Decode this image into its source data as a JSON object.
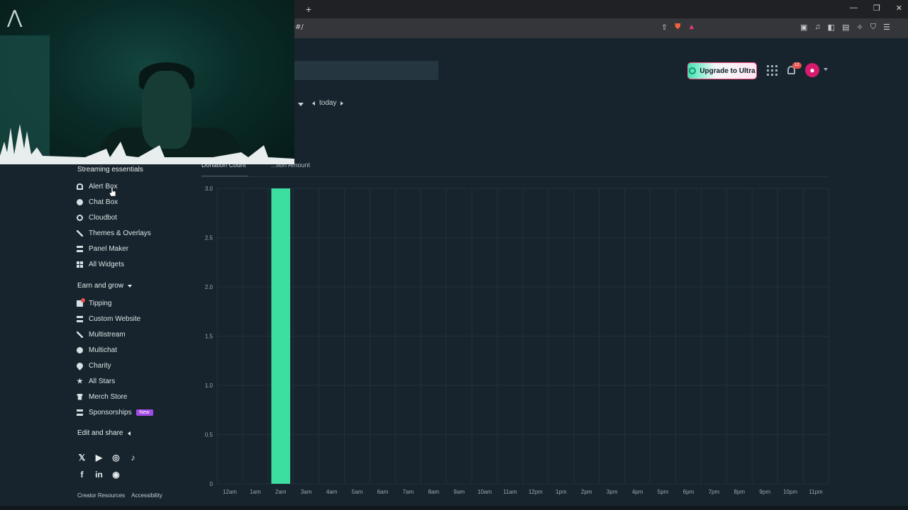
{
  "browser": {
    "url": "#/",
    "new_tab": "+",
    "window_controls": [
      "—",
      "❐",
      "✕"
    ]
  },
  "header": {
    "upgrade_label": "Upgrade to Ultra",
    "notification_count": "12",
    "date_nav_label": "today"
  },
  "sidebar": {
    "streaming_heading": "Streaming essentials",
    "streaming_items": [
      "Alert Box",
      "Chat Box",
      "Cloudbot",
      "Themes & Overlays",
      "Panel Maker",
      "All Widgets"
    ],
    "earn_heading": "Earn and grow",
    "earn_items": [
      "Tipping",
      "Custom Website",
      "Multistream",
      "Multichat",
      "Charity",
      "All Stars",
      "Merch Store",
      "Sponsorships"
    ],
    "new_badge": "New",
    "edit_heading": "Edit and share",
    "footer_links": [
      "Creator Resources",
      "Accessibility"
    ]
  },
  "tabs": {
    "donation_count": "Donation Count",
    "donation_amount": "...tion Amount"
  },
  "colors": {
    "bar": "#3ddfa0",
    "background": "#17242d",
    "accent_pink": "#d61a6d"
  },
  "chart_data": {
    "type": "bar",
    "categories": [
      "12am",
      "1am",
      "2am",
      "3am",
      "4am",
      "5am",
      "6am",
      "7am",
      "8am",
      "9am",
      "10am",
      "11am",
      "12pm",
      "1pm",
      "2pm",
      "3pm",
      "4pm",
      "5pm",
      "6pm",
      "7pm",
      "8pm",
      "9pm",
      "10pm",
      "11pm"
    ],
    "values": [
      0,
      0,
      3,
      0,
      0,
      0,
      0,
      0,
      0,
      0,
      0,
      0,
      0,
      0,
      0,
      0,
      0,
      0,
      0,
      0,
      0,
      0,
      0,
      0
    ],
    "y_ticks": [
      "0",
      "0.5",
      "1.0",
      "1.5",
      "2.0",
      "2.5",
      "3.0"
    ],
    "ylim": [
      0,
      3
    ],
    "grid": true
  }
}
